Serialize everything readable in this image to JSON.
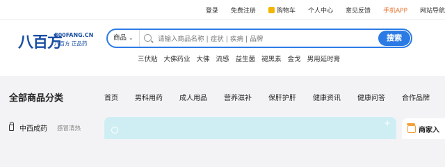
{
  "topbar": {
    "links": [
      "登录",
      "免费注册",
      "购物车",
      "个人中心",
      "意见反馈",
      "手机APP",
      "网站导航"
    ]
  },
  "logo": {
    "mark": "八百方",
    "domain": "800FANG.CN",
    "tagline": "八百方 正品药"
  },
  "search": {
    "category": "商品",
    "placeholder": "请输入商品名称 | 症状 | 疾病 | 品牌",
    "button": "搜索"
  },
  "hotwords": [
    "三伏贴",
    "大佛药业",
    "大佛",
    "流感",
    "益生菌",
    "褪黑素",
    "金戈",
    "男用延时膏"
  ],
  "nav": {
    "all_categories": "全部商品分类",
    "items": [
      "首页",
      "男科用药",
      "成人用品",
      "营养滋补",
      "保肝护肝",
      "健康资讯",
      "健康问答",
      "合作品牌"
    ]
  },
  "sidebar": {
    "category": "中西成药",
    "sub": "感冒清热"
  },
  "merchant": {
    "label": "商家入"
  },
  "colors": {
    "brand_blue": "#2c7be5",
    "app_orange": "#e8702a",
    "banner": "#cfeef4"
  }
}
